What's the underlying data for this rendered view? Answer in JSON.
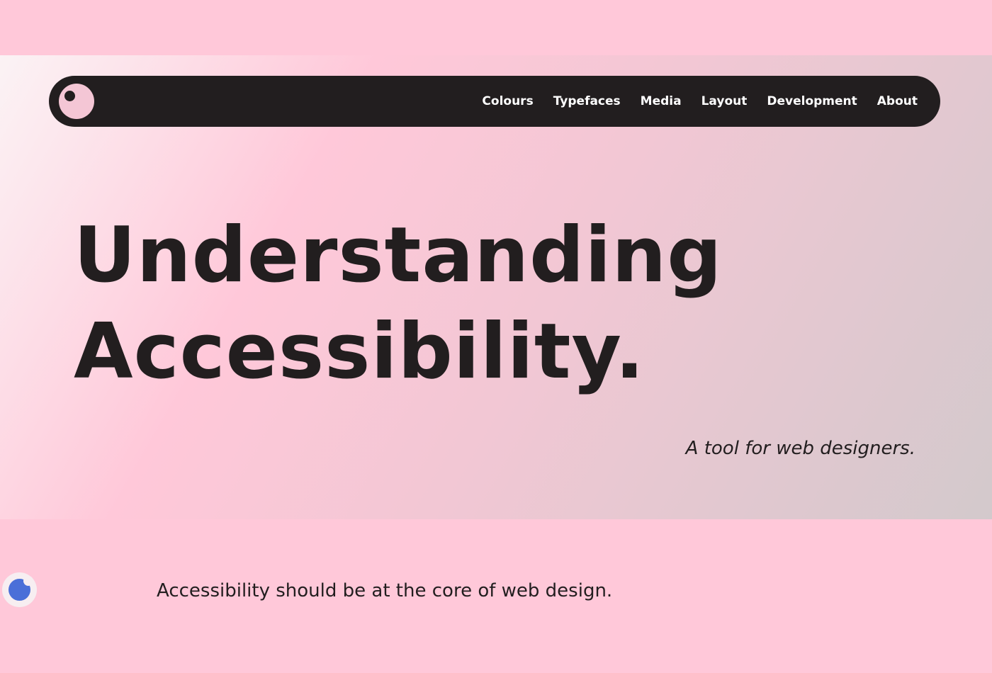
{
  "nav": {
    "items": [
      "Colours",
      "Typefaces",
      "Media",
      "Layout",
      "Development",
      "About"
    ]
  },
  "hero": {
    "title_line1": "Understanding",
    "title_line2": "Accessibility.",
    "tagline": "A tool for web designers."
  },
  "intro": "Accessibility should be at the core of web design.",
  "colors": {
    "background": "#ffc8d9",
    "nav": "#221e1f",
    "cookie": "#4a6fd8"
  }
}
